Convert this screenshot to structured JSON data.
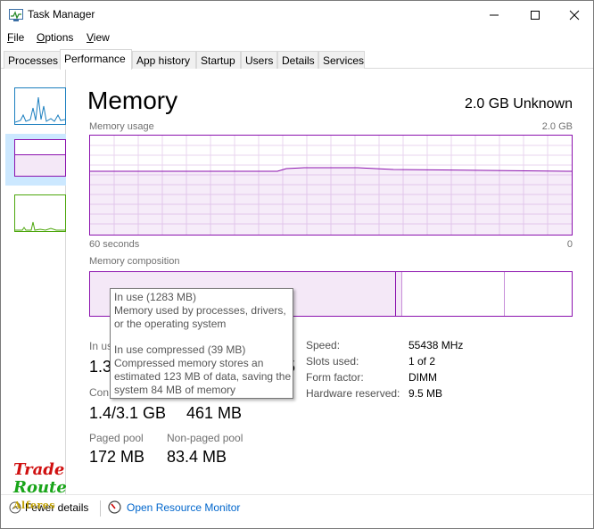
{
  "window": {
    "title": "Task Manager"
  },
  "menu": {
    "file": "File",
    "options": "Options",
    "view": "View"
  },
  "tabs": [
    {
      "label": "Processes"
    },
    {
      "label": "Performance"
    },
    {
      "label": "App history"
    },
    {
      "label": "Startup"
    },
    {
      "label": "Users"
    },
    {
      "label": "Details"
    },
    {
      "label": "Services"
    }
  ],
  "sidebar": {
    "items": [
      {
        "name": "cpu",
        "color": "#1c7fbf"
      },
      {
        "name": "memory",
        "color": "#8b12ae"
      },
      {
        "name": "ethernet",
        "color": "#4da60c"
      }
    ]
  },
  "memory": {
    "title": "Memory",
    "capacity": "2.0 GB Unknown",
    "usage_label": "Memory usage",
    "usage_max": "2.0 GB",
    "time_left": "60 seconds",
    "time_right": "0",
    "composition_label": "Memory composition",
    "accent": "#8b12ae"
  },
  "tooltip": {
    "line1": "In use (1283 MB)",
    "line2": "Memory used by processes, drivers,",
    "line3": "or the operating system",
    "line4": "In use compressed (39 MB)",
    "line5": "Compressed memory stores an",
    "line6": "estimated 123 MB of data, saving the",
    "line7": "system 84 MB of memory"
  },
  "stats": {
    "in_use_label": "In us",
    "in_use_value": "1.3",
    "available_value_tail": "5",
    "committed_label": "Con",
    "committed_value": "1.4/3.1 GB",
    "cached_value": "461 MB",
    "paged_pool_label": "Paged pool",
    "paged_pool_value": "172 MB",
    "nonpaged_pool_label": "Non-paged pool",
    "nonpaged_pool_value": "83.4 MB"
  },
  "details": {
    "speed_label": "Speed:",
    "speed_value": "55438 MHz",
    "slots_label": "Slots used:",
    "slots_value": "1 of 2",
    "form_label": "Form factor:",
    "form_value": "DIMM",
    "reserved_label": "Hardware reserved:",
    "reserved_value": "9.5 MB"
  },
  "bottom": {
    "fewer_details": "Fewer details",
    "open_resource_monitor": "Open Resource Monitor"
  },
  "watermark": {
    "line1": "Trade",
    "line2": "Route",
    "line3": "Alferes"
  }
}
